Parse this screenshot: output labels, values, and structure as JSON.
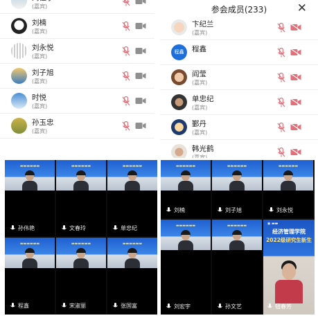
{
  "right_panel": {
    "title": "参会成员(233)"
  },
  "left_participants": [
    {
      "name": "刘佳宁",
      "role": "(嘉宾)",
      "avatar": "snow-mountain"
    },
    {
      "name": "刘楠",
      "role": "(嘉宾)",
      "avatar": "panda"
    },
    {
      "name": "刘永悦",
      "role": "(嘉宾)",
      "avatar": "grid-pattern"
    },
    {
      "name": "刘子旭",
      "role": "(嘉宾)",
      "avatar": "sea-photo"
    },
    {
      "name": "时悦",
      "role": "(嘉宾)",
      "avatar": "sky-photo"
    },
    {
      "name": "孙玉忠",
      "role": "(嘉宾)",
      "avatar": "field-photo"
    }
  ],
  "right_participants": [
    {
      "name": "卞纪兰",
      "role": "(嘉宾)",
      "avatar": "cartoon-child"
    },
    {
      "name": "程鑫",
      "role": "",
      "avatar_text": "程鑫"
    },
    {
      "name": "阎莹",
      "role": "(嘉宾)",
      "avatar": "cartoon-girl"
    },
    {
      "name": "单忠纪",
      "role": "(嘉宾)",
      "avatar": "man-photo"
    },
    {
      "name": "鄞丹",
      "role": "(嘉宾)",
      "avatar": "cartoon-figure"
    },
    {
      "name": "韩光鹤",
      "role": "(嘉宾)",
      "avatar": "portrait"
    }
  ],
  "left_grid": {
    "tiles": [
      {
        "name": "孙伟艳"
      },
      {
        "name": "文春玲"
      },
      {
        "name": "单忠纪"
      },
      {
        "name": "程鑫"
      },
      {
        "name": "宋淑丽"
      },
      {
        "name": "张国富"
      }
    ]
  },
  "right_grid": {
    "tiles": [
      {
        "name": "刘楠"
      },
      {
        "name": "刘子旭"
      },
      {
        "name": "刘永悦"
      },
      {
        "name": "刘宏宇"
      },
      {
        "name": "孙文艺"
      }
    ],
    "featured": {
      "name": "钮春芳",
      "school": "经济管理学院",
      "event": "2022级研究生新生"
    }
  },
  "colors": {
    "muted_red": "#e0707a",
    "icon_gray": "#9a9a9a",
    "av_blue": "#1e6fd9"
  }
}
